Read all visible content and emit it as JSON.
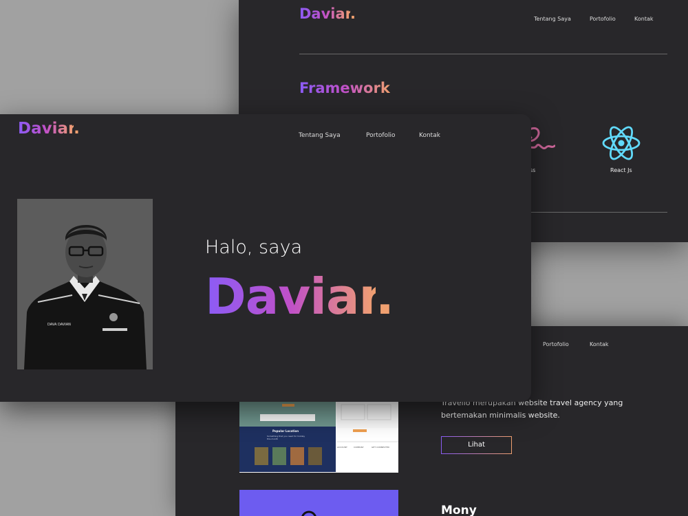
{
  "top_card": {
    "logo": "Daviar",
    "logo_dot": ".",
    "nav": [
      "Tentang Saya",
      "Portofolio",
      "Kontak"
    ],
    "section_title": "Framework",
    "frameworks": [
      {
        "label": "ss",
        "icon": "sass-icon"
      },
      {
        "label": "React Js",
        "icon": "react-icon"
      }
    ]
  },
  "front_card": {
    "logo": "Daviar",
    "logo_dot": ".",
    "nav": [
      "Tentang Saya",
      "Portofolio",
      "Kontak"
    ],
    "greeting": "Halo, saya",
    "hero_name": "Daviar",
    "hero_dot": ".",
    "photo_badge": "DAVA DAVIAN"
  },
  "bottom_card": {
    "nav": [
      "Portofolio",
      "Kontak"
    ],
    "description": "Travello merupakan website travel agency yang bertemakan minimalis website.",
    "button_label": "Lihat",
    "project2_title": "Mony",
    "preview": {
      "tagline": "Popular Location",
      "sub_tagline": "Something that you need for holiday this month",
      "columns": [
        "ACCOUNT",
        "COMPANY",
        "GET CONNECTED"
      ]
    }
  },
  "colors": {
    "card_bg": "#28272a",
    "backdrop": "#a1a1a1",
    "gradient_start": "#8b5cf6",
    "gradient_mid": "#c050c8",
    "gradient_end": "#f0a070",
    "react_blue": "#61dafb",
    "sass_pink": "#cc6699"
  }
}
